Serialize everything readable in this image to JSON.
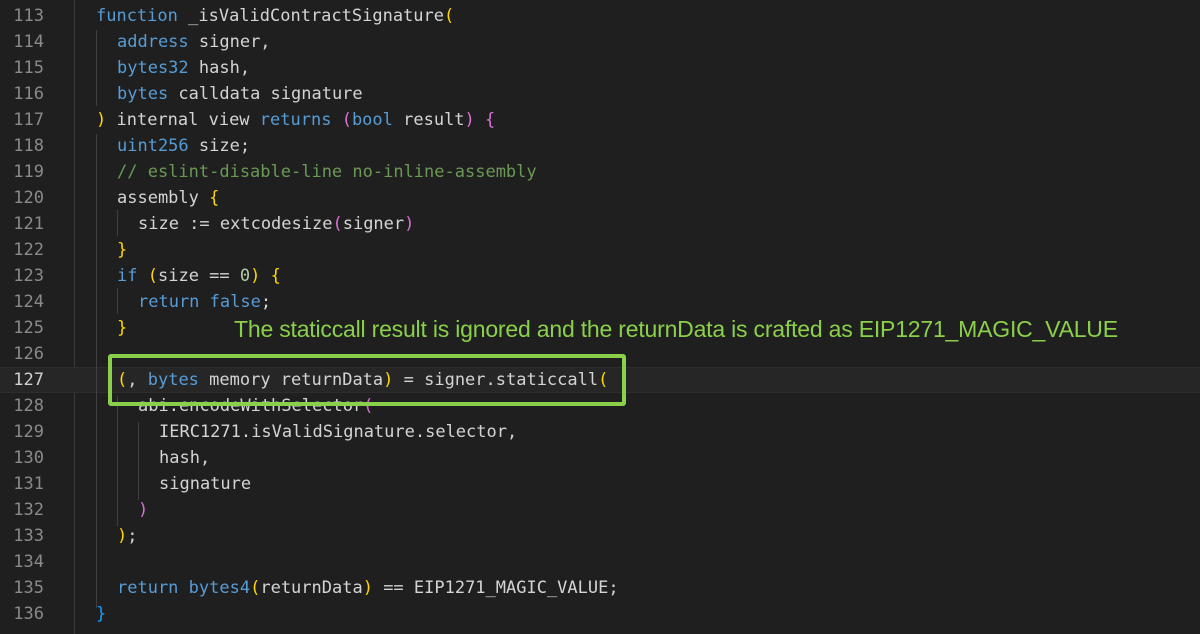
{
  "editor": {
    "theme": {
      "background": "#1f1f1f",
      "keyword": "#569cd6",
      "type": "#4fc1ff",
      "comment": "#6a9955",
      "annotation": "#8bd04a"
    },
    "lines": [
      {
        "num": "113",
        "t": [
          "function",
          " _isValidContractSignature",
          "("
        ]
      },
      {
        "num": "114",
        "t": [
          "address",
          " signer,"
        ]
      },
      {
        "num": "115",
        "t": [
          "bytes32",
          " hash,"
        ]
      },
      {
        "num": "116",
        "t": [
          "bytes",
          " calldata signature"
        ]
      },
      {
        "num": "117",
        "t": [
          ")",
          " internal view ",
          "returns",
          " ",
          "(",
          "bool",
          " result",
          ")",
          " ",
          "{"
        ]
      },
      {
        "num": "118",
        "t": [
          "uint256",
          " size;"
        ]
      },
      {
        "num": "119",
        "t": [
          "// eslint-disable-line no-inline-assembly"
        ]
      },
      {
        "num": "120",
        "t": [
          "assembly ",
          "{"
        ]
      },
      {
        "num": "121",
        "t": [
          "size := extcodesize",
          "(",
          "signer",
          ")"
        ]
      },
      {
        "num": "122",
        "t": [
          "}"
        ]
      },
      {
        "num": "123",
        "t": [
          "if",
          " ",
          "(",
          "size == ",
          "0",
          ")",
          " ",
          "{"
        ]
      },
      {
        "num": "124",
        "t": [
          "return",
          " ",
          "false",
          ";"
        ]
      },
      {
        "num": "125",
        "t": [
          "}"
        ]
      },
      {
        "num": "126",
        "t": []
      },
      {
        "num": "127",
        "t": [
          "(",
          ", ",
          "bytes",
          " memory returnData",
          ")",
          " = signer.staticcall",
          "("
        ]
      },
      {
        "num": "128",
        "t": [
          "abi.encodeWithSelector",
          "("
        ]
      },
      {
        "num": "129",
        "t": [
          "IERC1271.isValidSignature.selector,"
        ]
      },
      {
        "num": "130",
        "t": [
          "hash,"
        ]
      },
      {
        "num": "131",
        "t": [
          "signature"
        ]
      },
      {
        "num": "132",
        "t": [
          ")"
        ]
      },
      {
        "num": "133",
        "t": [
          ")",
          ";"
        ]
      },
      {
        "num": "134",
        "t": []
      },
      {
        "num": "135",
        "t": [
          "return",
          " ",
          "bytes4",
          "(",
          "returnData",
          ")",
          " == EIP1271_MAGIC_VALUE;"
        ]
      },
      {
        "num": "136",
        "t": [
          "}"
        ]
      }
    ]
  },
  "annotation": {
    "text": "The staticcall result is ignored and the returnData is crafted as EIP1271_MAGIC_VALUE"
  }
}
